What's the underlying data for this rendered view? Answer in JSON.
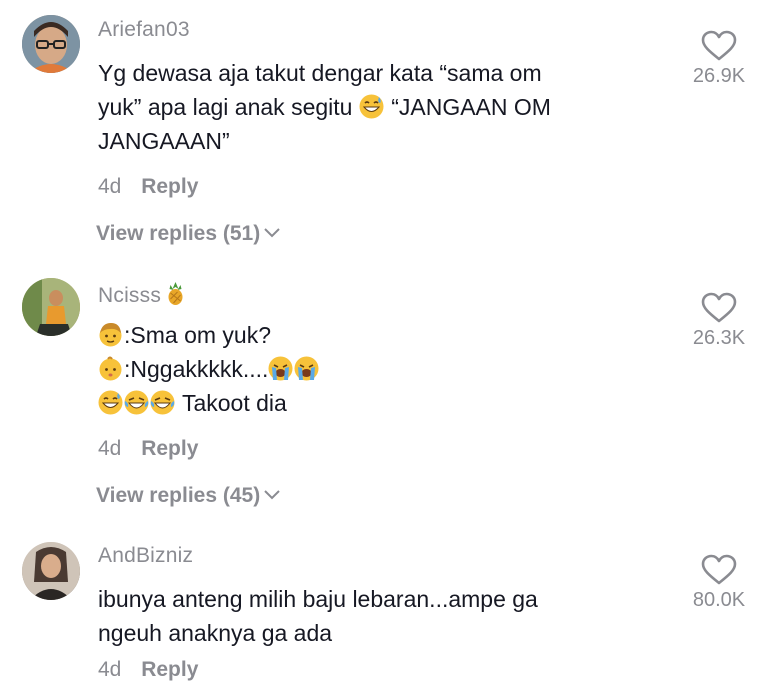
{
  "comments": [
    {
      "username": "Ariefan03",
      "text_line1": "Yg dewasa aja takut dengar kata “sama om",
      "text_line2a": "yuk” apa lagi anak segitu ",
      "text_line2b": " “JANGAAN OM",
      "text_line3": "JANGAAAN”",
      "date": "4d",
      "reply_label": "Reply",
      "view_replies": "View replies (51)",
      "like_count": "26.9K",
      "emojis": [
        "grinning-sweat-emoji"
      ]
    },
    {
      "username": "Ncisss",
      "username_emoji": "pineapple-emoji",
      "line1": ":Sma om yuk?",
      "line2": ":Nggakkkkk....",
      "line3": " Takoot dia",
      "date": "4d",
      "reply_label": "Reply",
      "view_replies": "View replies (45)",
      "like_count": "26.3K",
      "emojis": [
        "boy-emoji",
        "baby-emoji",
        "crying-emoji",
        "crying-emoji",
        "grinning-sweat-emoji",
        "tears-of-joy-emoji",
        "tears-of-joy-emoji"
      ]
    },
    {
      "username": "AndBizniz",
      "text_line1": "ibunya anteng milih baju lebaran...ampe ga",
      "text_line2": "ngeuh anaknya ga ada",
      "date": "4d",
      "reply_label": "Reply",
      "like_count": "80.0K"
    }
  ],
  "colors": {
    "text": "#161823",
    "secondary": "#8a8b91",
    "emoji_yellow": "#f7c23a"
  }
}
